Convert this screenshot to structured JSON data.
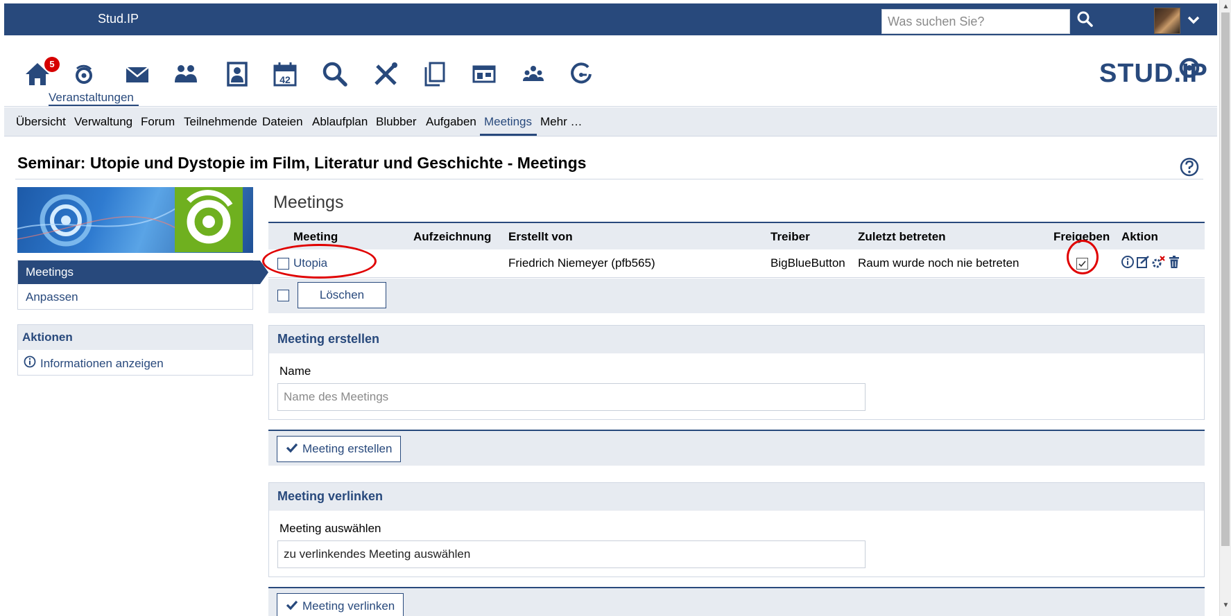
{
  "topbar": {
    "brand": "Stud.IP",
    "search_placeholder": "Was suchen Sie?"
  },
  "navbar": {
    "icons": [
      "home-icon",
      "courses-icon",
      "mail-icon",
      "community-icon",
      "profile-icon",
      "calendar-icon",
      "search-icon",
      "tools-icon",
      "files-icon",
      "schedule-icon",
      "contacts-icon",
      "plugin-icon"
    ],
    "home_badge": "5",
    "active_label": "Veranstaltungen",
    "calendar_day": "42",
    "logo_text": "STUD.IP"
  },
  "tabs": [
    "Übersicht",
    "Verwaltung",
    "Forum",
    "Teilnehmende",
    "Dateien",
    "Ablaufplan",
    "Blubber",
    "Aufgaben",
    "Meetings",
    "Mehr …"
  ],
  "active_tab": "Meetings",
  "page_title": "Seminar: Utopie und Dystopie im Film, Literatur und Geschichte - Meetings",
  "sidebar": {
    "nav": [
      {
        "label": "Meetings",
        "active": true
      },
      {
        "label": "Anpassen",
        "active": false
      }
    ],
    "actions_title": "Aktionen",
    "actions": [
      {
        "label": "Informationen anzeigen",
        "icon": "info-icon"
      }
    ]
  },
  "meetings": {
    "title": "Meetings",
    "columns": [
      "Meeting",
      "Aufzeichnung",
      "Erstellt von",
      "Treiber",
      "Zuletzt betreten",
      "Freigeben",
      "Aktion"
    ],
    "rows": [
      {
        "name": "Utopia",
        "recording": "",
        "created_by": "Friedrich Niemeyer (pfb565)",
        "driver": "BigBlueButton",
        "last_joined": "Raum wurde noch nie betreten",
        "shared": true
      }
    ],
    "delete_button": "Löschen",
    "action_icons": [
      "info-icon",
      "edit-icon",
      "settings-icon",
      "trash-icon"
    ]
  },
  "create": {
    "title": "Meeting erstellen",
    "name_label": "Name",
    "name_placeholder": "Name des Meetings",
    "submit": "Meeting erstellen"
  },
  "link": {
    "title": "Meeting verlinken",
    "select_label": "Meeting auswählen",
    "select_value": "zu verlinkendes Meeting auswählen",
    "submit": "Meeting verlinken"
  }
}
